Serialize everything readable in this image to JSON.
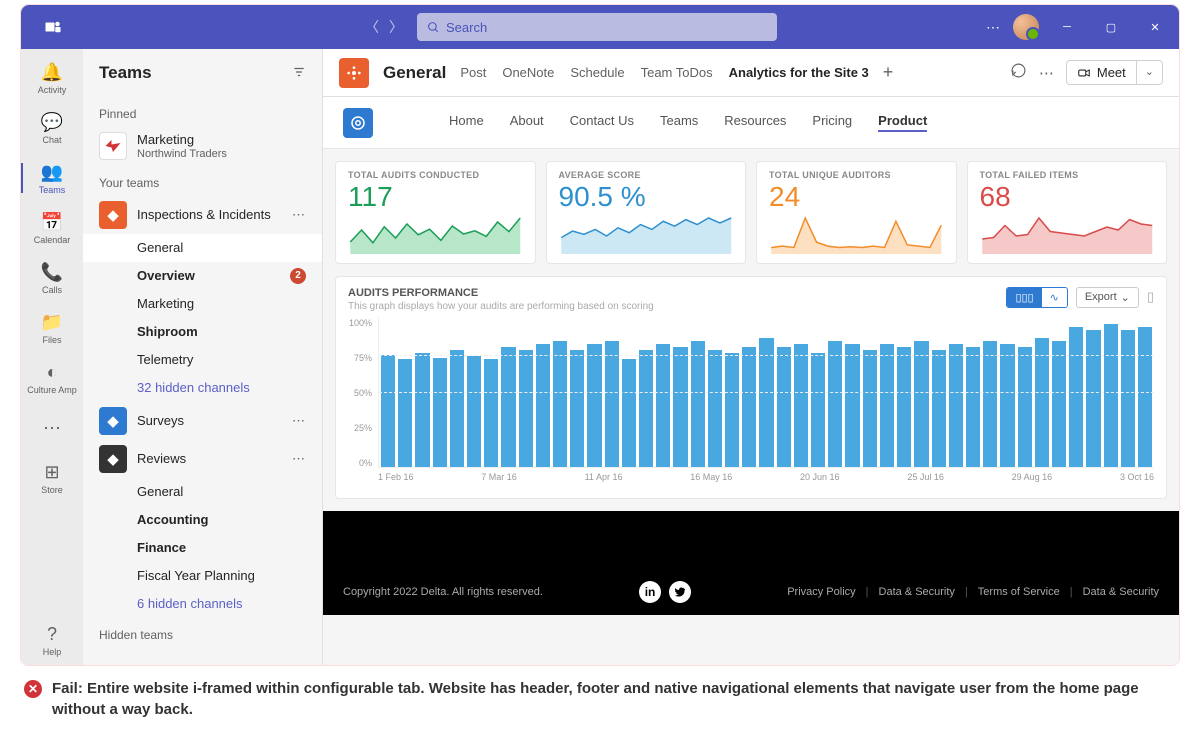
{
  "titlebar": {
    "search_placeholder": "Search"
  },
  "rail": [
    {
      "icon": "🔔",
      "label": "Activity"
    },
    {
      "icon": "💬",
      "label": "Chat"
    },
    {
      "icon": "👥",
      "label": "Teams",
      "active": true
    },
    {
      "icon": "📅",
      "label": "Calendar"
    },
    {
      "icon": "📞",
      "label": "Calls"
    },
    {
      "icon": "📁",
      "label": "Files"
    },
    {
      "icon": "◐",
      "label": "Culture Amp"
    },
    {
      "icon": "⋯",
      "label": ""
    },
    {
      "icon": "⊞",
      "label": "Store"
    }
  ],
  "rail_help": {
    "icon": "?",
    "label": "Help"
  },
  "sidebar": {
    "title": "Teams",
    "pinned_label": "Pinned",
    "pinned_team": {
      "name": "Marketing",
      "sub": "Northwind Traders",
      "color": "#fff"
    },
    "your_teams_label": "Your teams",
    "teams": [
      {
        "name": "Inspections & Incidents",
        "color": "#e9602e",
        "more": true,
        "channels": [
          {
            "name": "General",
            "active": true
          },
          {
            "name": "Overview",
            "bold": true,
            "badge": "2"
          },
          {
            "name": "Marketing"
          },
          {
            "name": "Shiproom",
            "bold": true
          },
          {
            "name": "Telemetry"
          },
          {
            "name": "32 hidden channels",
            "link": true
          }
        ]
      },
      {
        "name": "Surveys",
        "color": "#2e7ad1",
        "more": true,
        "channels": []
      },
      {
        "name": "Reviews",
        "color": "#333",
        "more": true,
        "channels": [
          {
            "name": "General"
          },
          {
            "name": "Accounting",
            "bold": true
          },
          {
            "name": "Finance",
            "bold": true
          },
          {
            "name": "Fiscal Year Planning"
          },
          {
            "name": "6 hidden channels",
            "link": true
          }
        ]
      }
    ],
    "hidden_teams_label": "Hidden teams"
  },
  "channel_header": {
    "title": "General",
    "tabs": [
      "Post",
      "OneNote",
      "Schedule",
      "Team ToDos"
    ],
    "active_tab": "Analytics for the Site 3",
    "meet_label": "Meet"
  },
  "site_nav": [
    "Home",
    "About",
    "Contact Us",
    "Teams",
    "Resources",
    "Pricing",
    "Product"
  ],
  "site_nav_active": "Product",
  "cards": [
    {
      "label": "TOTAL AUDITS CONDUCTED",
      "value": "117",
      "cls": "green"
    },
    {
      "label": "AVERAGE SCORE",
      "value": "90.5 %",
      "cls": "blue"
    },
    {
      "label": "TOTAL UNIQUE AUDITORS",
      "value": "24",
      "cls": "orange"
    },
    {
      "label": "TOTAL FAILED ITEMS",
      "value": "68",
      "cls": "red"
    }
  ],
  "chart_data": {
    "sparks": [
      {
        "type": "line",
        "fill": "#b8e6c8",
        "stroke": "#1a9e58",
        "values": [
          30,
          60,
          28,
          68,
          40,
          75,
          48,
          62,
          34,
          70,
          50,
          58,
          44,
          80,
          56,
          90
        ]
      },
      {
        "type": "area",
        "fill": "#cce8f5",
        "stroke": "#2e8fd1",
        "values": [
          20,
          28,
          24,
          30,
          22,
          32,
          26,
          36,
          30,
          40,
          34,
          42,
          36,
          44,
          38,
          44
        ]
      },
      {
        "type": "line",
        "fill": "#fde0c2",
        "stroke": "#f28c28",
        "values": [
          10,
          12,
          10,
          55,
          18,
          12,
          10,
          11,
          10,
          12,
          10,
          50,
          14,
          12,
          10,
          44
        ]
      },
      {
        "type": "line",
        "fill": "#f6c9c9",
        "stroke": "#d94a4a",
        "values": [
          20,
          22,
          38,
          24,
          26,
          48,
          30,
          28,
          26,
          24,
          30,
          36,
          32,
          46,
          40,
          38
        ]
      }
    ],
    "bar_chart": {
      "type": "bar",
      "title": "AUDITS PERFORMANCE",
      "subtitle": "This graph displays how your audits are performing based on scoring",
      "y_ticks": [
        "100%",
        "75%",
        "50%",
        "25%",
        "0%"
      ],
      "ylim": [
        0,
        100
      ],
      "x_ticks": [
        "1 Feb 16",
        "7 Mar 16",
        "11 Apr 16",
        "16 May 16",
        "20 Jun 16",
        "25 Jul 16",
        "29 Aug 16",
        "3 Oct 16"
      ],
      "values": [
        75,
        72,
        76,
        73,
        78,
        74,
        72,
        80,
        78,
        82,
        84,
        78,
        82,
        84,
        72,
        78,
        82,
        80,
        84,
        78,
        76,
        80,
        86,
        80,
        82,
        76,
        84,
        82,
        78,
        82,
        80,
        84,
        78,
        82,
        80,
        84,
        82,
        80,
        86,
        84,
        94,
        92,
        96,
        92,
        94
      ],
      "export_label": "Export"
    }
  },
  "footer": {
    "copyright": "Copyright 2022 Delta. All rights reserved.",
    "links": [
      "Privacy Policy",
      "Data & Security",
      "Terms of Service",
      "Data & Security"
    ]
  },
  "fail_note": "Fail: Entire website i-framed within configurable tab. Website has header, footer and native navigational elements that navigate user from the home page without a way back."
}
